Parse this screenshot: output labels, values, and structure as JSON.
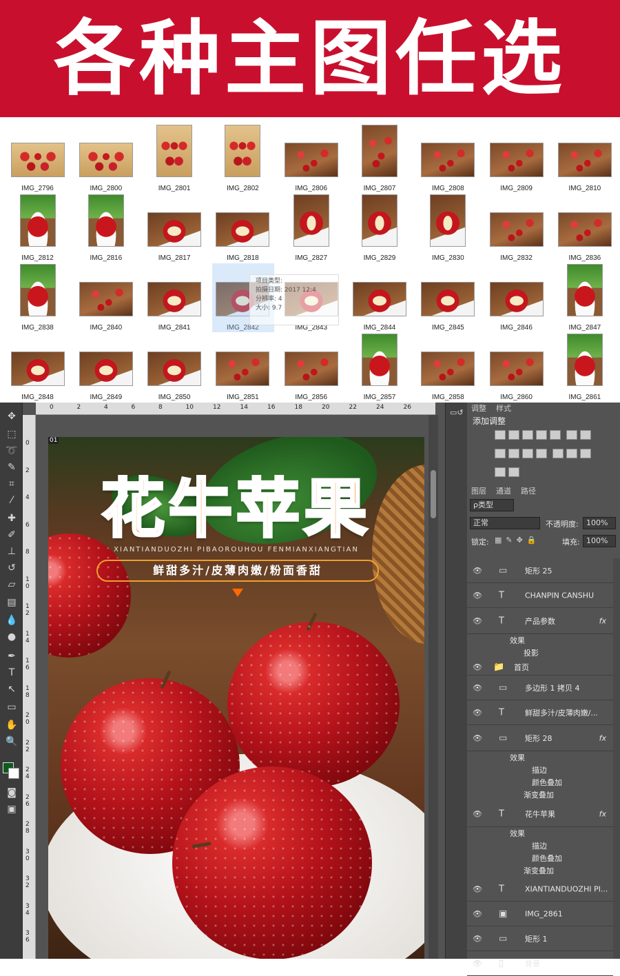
{
  "banner": {
    "title": "各种主图任选"
  },
  "gallery": {
    "rows": [
      [
        {
          "name": "IMG_2796",
          "kind": "box"
        },
        {
          "name": "IMG_2800",
          "kind": "box"
        },
        {
          "name": "IMG_2801",
          "kind": "box"
        },
        {
          "name": "IMG_2802",
          "kind": "box"
        },
        {
          "name": "IMG_2806",
          "kind": "red"
        },
        {
          "name": "IMG_2807",
          "kind": "red"
        },
        {
          "name": "IMG_2808",
          "kind": "red"
        },
        {
          "name": "IMG_2809",
          "kind": "red"
        },
        {
          "name": "IMG_2810",
          "kind": "red"
        }
      ],
      [
        {
          "name": "IMG_2812",
          "kind": "leaf"
        },
        {
          "name": "IMG_2816",
          "kind": "leaf"
        },
        {
          "name": "IMG_2817",
          "kind": "cut"
        },
        {
          "name": "IMG_2818",
          "kind": "cut"
        },
        {
          "name": "IMG_2827",
          "kind": "cut"
        },
        {
          "name": "IMG_2829",
          "kind": "cut"
        },
        {
          "name": "IMG_2830",
          "kind": "cut"
        },
        {
          "name": "IMG_2832",
          "kind": "red"
        },
        {
          "name": "IMG_2836",
          "kind": "red"
        }
      ],
      [
        {
          "name": "IMG_2838",
          "kind": "leaf"
        },
        {
          "name": "IMG_2840",
          "kind": "red"
        },
        {
          "name": "IMG_2841",
          "kind": "cut"
        },
        {
          "name": "IMG_2842",
          "kind": "cut"
        },
        {
          "name": "IMG_2843",
          "kind": "cut"
        },
        {
          "name": "IMG_2844",
          "kind": "cut"
        },
        {
          "name": "IMG_2845",
          "kind": "cut"
        },
        {
          "name": "IMG_2846",
          "kind": "cut"
        },
        {
          "name": "IMG_2847",
          "kind": "leaf"
        }
      ],
      [
        {
          "name": "IMG_2848",
          "kind": "cut"
        },
        {
          "name": "IMG_2849",
          "kind": "cut"
        },
        {
          "name": "IMG_2850",
          "kind": "cut"
        },
        {
          "name": "IMG_2851",
          "kind": "red"
        },
        {
          "name": "IMG_2856",
          "kind": "red"
        },
        {
          "name": "IMG_2857",
          "kind": "leaf"
        },
        {
          "name": "IMG_2858",
          "kind": "red"
        },
        {
          "name": "IMG_2860",
          "kind": "red"
        },
        {
          "name": "IMG_2861",
          "kind": "leaf"
        }
      ]
    ],
    "tooltip": [
      "项目类型:",
      "拍摄日期: 2017 12:4",
      "分辨率: 4",
      "大小: 9.7"
    ]
  },
  "rulers": {
    "top": [
      "0",
      "2",
      "4",
      "6",
      "8",
      "10",
      "12",
      "14",
      "16",
      "18",
      "20",
      "22",
      "24",
      "26"
    ],
    "left": [
      "0",
      "2",
      "4",
      "6",
      "8",
      "1 0",
      "1 2",
      "1 4",
      "1 6",
      "1 8",
      "2 0",
      "2 2",
      "2 4",
      "2 6",
      "2 8",
      "3 0",
      "3 2",
      "3 4",
      "3 6"
    ]
  },
  "canvas": {
    "tab": "01",
    "title": "花牛苹果",
    "pinyin": "XIANTIANDUOZHI PIBAOROUHOU FENMIANXIANGTIAN",
    "slogan": "鲜甜多汁/皮薄肉嫩/粉面香甜"
  },
  "panels": {
    "top_tabs": [
      "调整",
      "样式"
    ],
    "adjust_title": "添加调整",
    "layer_tabs": [
      "图层",
      "通道",
      "路径"
    ],
    "filter_kind": "ρ类型",
    "blend_mode": "正常",
    "opacity_label": "不透明度:",
    "opacity": "100%",
    "lock_label": "锁定:",
    "fill_label": "填充:",
    "fill": "100%",
    "layers": [
      {
        "name": "矩形 25",
        "icon": "shape",
        "fx": ""
      },
      {
        "name": "CHANPIN CANSHU",
        "icon": "text",
        "fx": ""
      },
      {
        "name": "产品参数",
        "icon": "text",
        "fx": "fx",
        "effects": [
          "效果",
          "投影"
        ]
      },
      {
        "name": "首页",
        "icon": "folder",
        "fx": ""
      },
      {
        "name": "多边形 1 拷贝 4",
        "icon": "shape",
        "fx": ""
      },
      {
        "name": "鲜甜多汁/皮薄肉嫩/...",
        "icon": "text",
        "fx": ""
      },
      {
        "name": "矩形 28",
        "icon": "shape",
        "fx": "fx",
        "effects": [
          "效果",
          "描边",
          "颜色叠加",
          "渐变叠加"
        ]
      },
      {
        "name": "花牛苹果",
        "icon": "text",
        "fx": "fx",
        "effects": [
          "效果",
          "描边",
          "颜色叠加",
          "渐变叠加"
        ]
      },
      {
        "name": "XIANTIANDUOZHI PI...",
        "icon": "text",
        "fx": ""
      },
      {
        "name": "IMG_2861",
        "icon": "smart",
        "fx": ""
      },
      {
        "name": "矩形 1",
        "icon": "shape",
        "fx": ""
      },
      {
        "name": "背景",
        "icon": "bg",
        "fx": ""
      }
    ]
  }
}
